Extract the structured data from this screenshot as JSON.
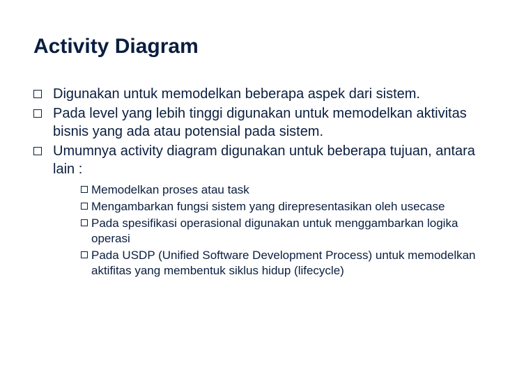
{
  "title": "Activity Diagram",
  "bullets": [
    {
      "text": "Digunakan  untuk memodelkan beberapa aspek dari sistem."
    },
    {
      "text": "Pada level yang lebih tinggi digunakan untuk memodelkan aktivitas bisnis yang ada atau potensial pada sistem."
    },
    {
      "text": "Umumnya activity diagram digunakan untuk beberapa tujuan, antara lain :"
    }
  ],
  "sub_bullets": [
    {
      "text": "Memodelkan proses atau task"
    },
    {
      "text": "Mengambarkan fungsi sistem yang direpresentasikan oleh usecase"
    },
    {
      "text": "Pada spesifikasi operasional digunakan untuk menggambarkan logika operasi"
    },
    {
      "text": "Pada USDP (Unified Software Development Process) untuk memodelkan aktifitas yang membentuk siklus hidup (lifecycle)"
    }
  ]
}
